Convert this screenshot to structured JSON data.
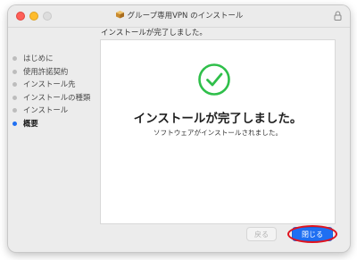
{
  "window": {
    "title": "グループ専用VPN のインストール"
  },
  "header": {
    "text": "インストールが完了しました。"
  },
  "sidebar": {
    "steps": [
      {
        "label": "はじめに",
        "active": false
      },
      {
        "label": "使用許諾契約",
        "active": false
      },
      {
        "label": "インストール先",
        "active": false
      },
      {
        "label": "インストールの種類",
        "active": false
      },
      {
        "label": "インストール",
        "active": false
      },
      {
        "label": "概要",
        "active": true
      }
    ]
  },
  "content": {
    "heading": "インストールが完了しました。",
    "message": "ソフトウェアがインストールされました。"
  },
  "buttons": {
    "back": "戻る",
    "close": "閉じる"
  },
  "colors": {
    "accent": "#1f6ff2",
    "success": "#2fbf4a",
    "highlight": "#e0141f"
  },
  "icons": {
    "title": "package-icon",
    "lock": "lock-icon",
    "success": "checkmark-circle-icon"
  }
}
